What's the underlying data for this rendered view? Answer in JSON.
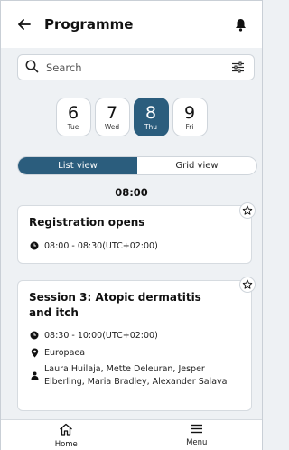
{
  "header": {
    "title": "Programme"
  },
  "search": {
    "placeholder": "Search"
  },
  "dates": [
    {
      "num": "6",
      "day": "Tue",
      "active": false
    },
    {
      "num": "7",
      "day": "Wed",
      "active": false
    },
    {
      "num": "8",
      "day": "Thu",
      "active": true
    },
    {
      "num": "9",
      "day": "Fri",
      "active": false
    }
  ],
  "view_toggle": {
    "list": "List view",
    "grid": "Grid view",
    "selected": "list"
  },
  "time_heading": "08:00",
  "sessions": [
    {
      "title": "Registration opens",
      "time": "08:00 - 08:30(UTC+02:00)"
    },
    {
      "title": "Session 3: Atopic dermatitis and itch",
      "time": "08:30 - 10:00(UTC+02:00)",
      "location": "Europaea",
      "speakers": "Laura Huilaja, Mette Deleuran, Jesper Elberling, Maria Bradley, Alexander Salava"
    }
  ],
  "bottom_nav": {
    "home": "Home",
    "menu": "Menu"
  },
  "colors": {
    "accent": "#2b5d7d",
    "background": "#eef1f4"
  }
}
